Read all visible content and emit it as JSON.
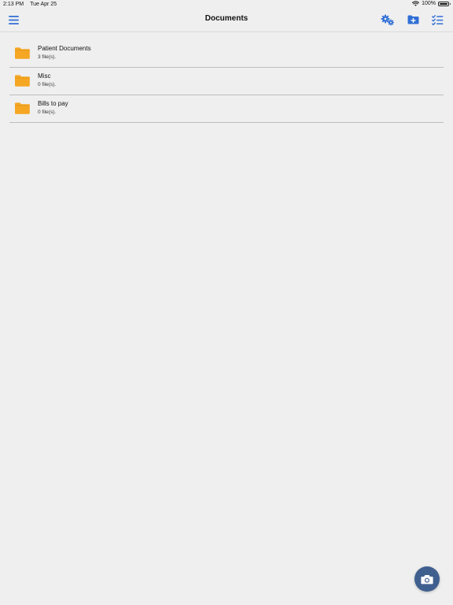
{
  "status_bar": {
    "time": "2:13 PM",
    "date": "Tue Apr 25",
    "battery": "100%",
    "battery_level": 1.0
  },
  "nav": {
    "title": "Documents",
    "icons": [
      "menu-icon",
      "settings-gears-icon",
      "new-folder-icon",
      "checklist-icon"
    ]
  },
  "items": [
    {
      "name": "Patient Documents",
      "count": "3 file(s)."
    },
    {
      "name": "Misc",
      "count": "0 file(s)."
    },
    {
      "name": "Bills to pay",
      "count": "0 file(s)."
    }
  ],
  "colors": {
    "accent": "#2f6fd6",
    "folder": "#f5a623",
    "fab": "#3f5f8f",
    "background": "#efefef"
  },
  "fab": {
    "icon": "camera-icon"
  }
}
